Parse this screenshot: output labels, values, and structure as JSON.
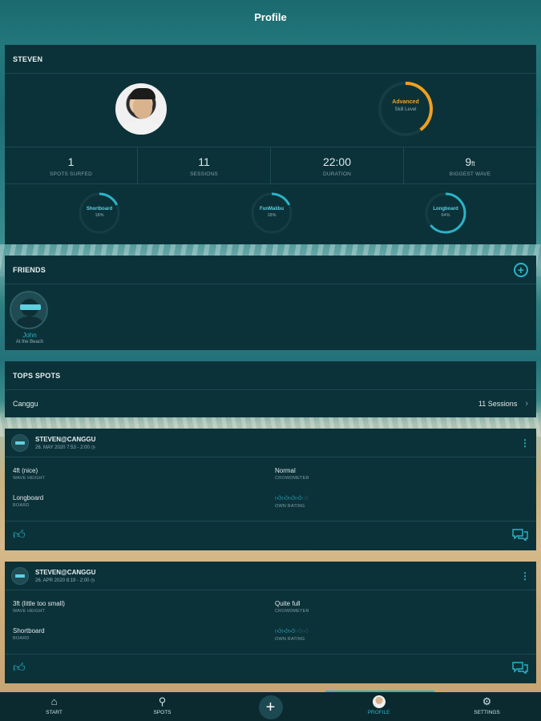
{
  "header": {
    "title": "Profile"
  },
  "profile": {
    "name": "STEVEN",
    "skill": {
      "level": "Advanced",
      "label": "Skill Level",
      "progress": 0.4
    },
    "stats": [
      {
        "value": "1",
        "unit": "",
        "label": "SPOTS SURFED"
      },
      {
        "value": "11",
        "unit": "",
        "label": "SESSIONS"
      },
      {
        "value": "22:00",
        "unit": "",
        "label": "DURATION"
      },
      {
        "value": "9",
        "unit": "ft",
        "label": "BIGGEST WAVE"
      }
    ],
    "boards": [
      {
        "name": "Shortboard",
        "percent": "18%",
        "fraction": 0.18
      },
      {
        "name": "FunMalibu",
        "percent": "18%",
        "fraction": 0.18
      },
      {
        "name": "Longboard",
        "percent": "64%",
        "fraction": 0.64
      }
    ]
  },
  "friends": {
    "title": "FRIENDS",
    "items": [
      {
        "name": "John",
        "status": "At the Beach"
      }
    ]
  },
  "top_spots": {
    "title": "TOPS SPOTS",
    "items": [
      {
        "name": "Canggu",
        "sessions": "11 Sessions"
      }
    ]
  },
  "sessions": [
    {
      "title": "STEVEN@CANGGU",
      "date": "26. MAY 2020 7:53 - 2:00 ◷",
      "wave_height": "4ft (nice)",
      "wave_height_label": "WAVE HEIGHT",
      "crowd": "Normal",
      "crowd_label": "CROWDMETER",
      "board": "Longboard",
      "board_label": "BOARD",
      "rating": 4,
      "rating_label": "OWN RATING"
    },
    {
      "title": "STEVEN@CANGGU",
      "date": "26. APR 2020 8:19 - 2:00 ◷",
      "wave_height": "3ft (little too small)",
      "wave_height_label": "WAVE HEIGHT",
      "crowd": "Quite full",
      "crowd_label": "CROWDMETER",
      "board": "Shortboard",
      "board_label": "BOARD",
      "rating": 3,
      "rating_label": "OWN RATING"
    }
  ],
  "tabbar": {
    "tabs": [
      {
        "label": "START",
        "icon": "home-icon"
      },
      {
        "label": "SPOTS",
        "icon": "pin-icon"
      },
      {
        "label": "",
        "icon": "plus-icon"
      },
      {
        "label": "PROFILE",
        "icon": "avatar"
      },
      {
        "label": "SETTINGS",
        "icon": "gear-icon"
      }
    ],
    "active": "PROFILE"
  },
  "colors": {
    "accent": "#2bb4c8",
    "skill": "#f0a020",
    "card": "#0c3239"
  }
}
